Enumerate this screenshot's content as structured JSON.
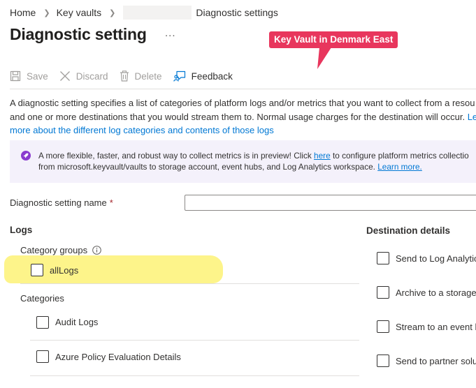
{
  "breadcrumb": {
    "home": "Home",
    "key_vaults": "Key vaults",
    "current": "Diagnostic settings"
  },
  "page": {
    "title": "Diagnostic setting",
    "more": "..."
  },
  "annotation": {
    "callout_text": "Key Vault in Denmark East",
    "callout_color": "#e8365d",
    "highlight_color": "#fdf48a"
  },
  "toolbar": {
    "save": "Save",
    "discard": "Discard",
    "delete": "Delete",
    "feedback": "Feedback"
  },
  "description": {
    "line1": "A diagnostic setting specifies a list of categories of platform logs and/or metrics that you want to collect from a resou",
    "line2_text": "and one or more destinations that you would stream them to. Normal usage charges for the destination will occur. ",
    "line2_link": "Le",
    "line3_link": "more about the different log categories and contents of those logs"
  },
  "banner": {
    "line1_pre": "A more flexible, faster, and robust way to collect metrics is in preview! Click ",
    "line1_link": "here",
    "line1_post": " to configure platform metrics collectio",
    "line2_pre": "from microsoft.keyvault/vaults to storage account, event hubs, and Log Analytics workspace. ",
    "line2_link": "Learn more.",
    "background": "#f4f1fb",
    "icon": "rocket-icon"
  },
  "form": {
    "name_label": "Diagnostic setting name",
    "required_marker": "*",
    "name_value": ""
  },
  "logs": {
    "heading": "Logs",
    "category_groups_label": "Category groups",
    "category_groups": [
      {
        "label": "allLogs",
        "checked": false
      }
    ],
    "categories_label": "Categories",
    "categories": [
      {
        "label": "Audit Logs",
        "checked": false
      },
      {
        "label": "Azure Policy Evaluation Details",
        "checked": false
      }
    ]
  },
  "destination": {
    "heading": "Destination details",
    "options": [
      {
        "label": "Send to Log Analytic",
        "checked": false
      },
      {
        "label": "Archive to a storage",
        "checked": false
      },
      {
        "label": "Stream to an event h",
        "checked": false
      },
      {
        "label": "Send to partner solu",
        "checked": false
      }
    ]
  },
  "colors": {
    "link": "#0078d4",
    "text": "#323130",
    "disabled": "#a19f9d"
  }
}
